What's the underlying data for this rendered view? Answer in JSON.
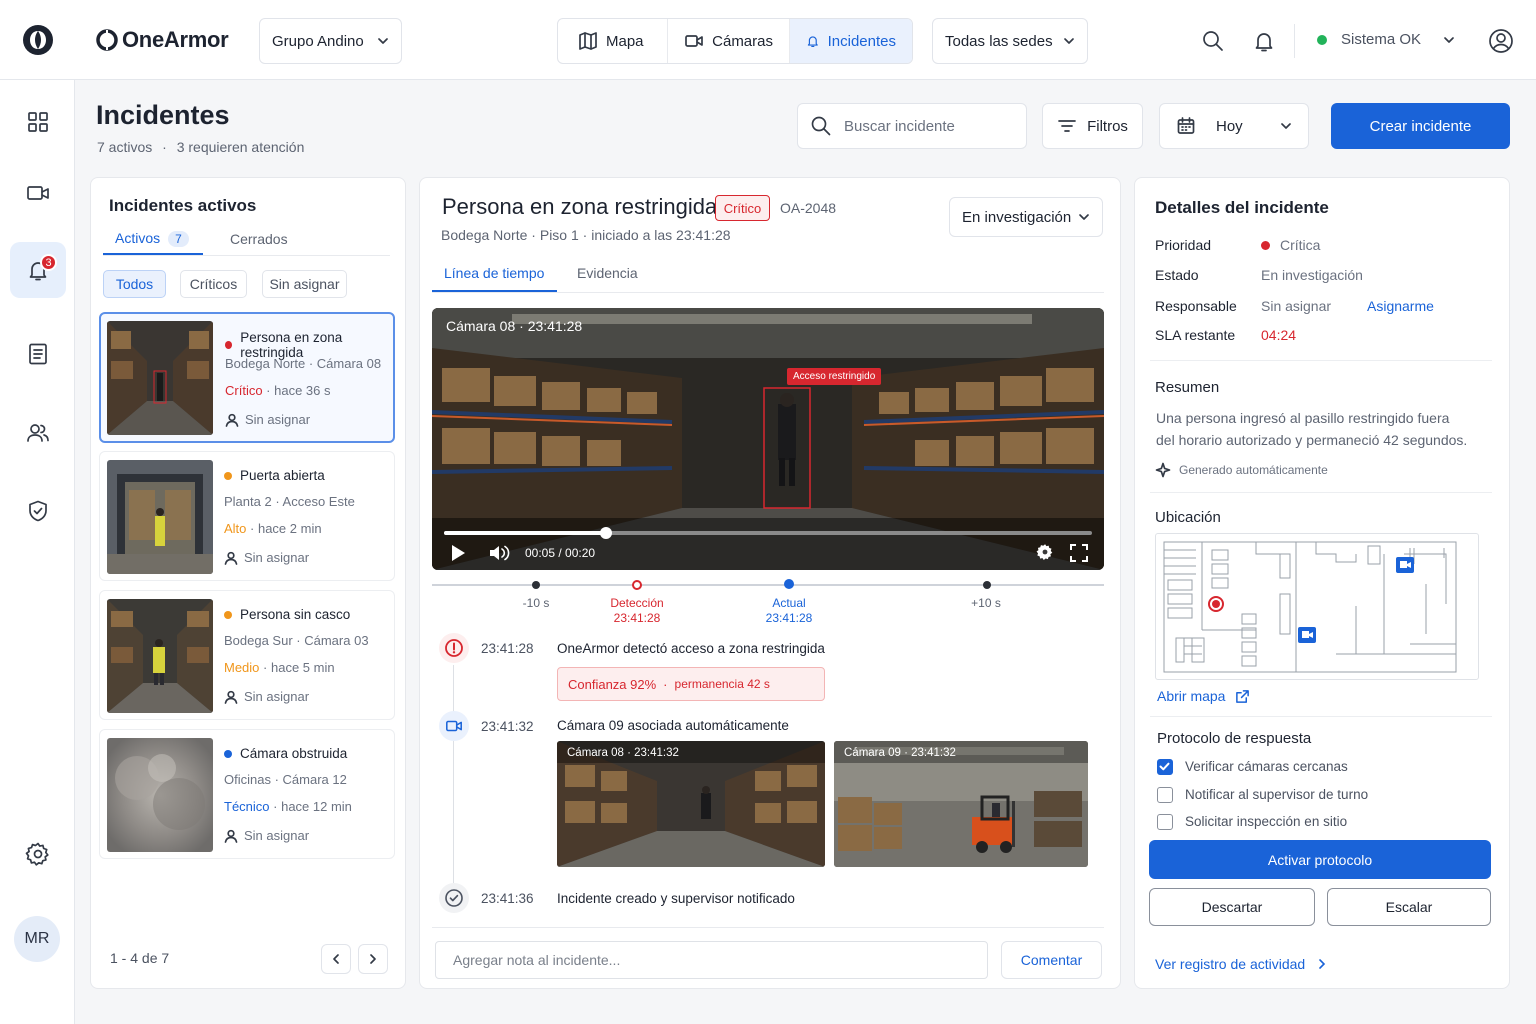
{
  "brand": {
    "name": "OneArmor",
    "logo_icon": "onearmor-logo-icon"
  },
  "topbar": {
    "org_select": "Grupo Andino",
    "nav": [
      {
        "label": "Mapa",
        "icon": "map-icon"
      },
      {
        "label": "Cámaras",
        "icon": "camera-icon"
      },
      {
        "label": "Incidentes",
        "icon": "bell-icon",
        "active": true
      }
    ],
    "site_select": "Todas las sedes",
    "system_status": "Sistema OK",
    "status_color": "#22b35a"
  },
  "sidebar": {
    "notifications_badge": "3",
    "avatar": "MR"
  },
  "header": {
    "title": "Incidentes",
    "subtitle_active": "7 activos",
    "subtitle_attention": "3 requieren atención",
    "search_placeholder": "Buscar incidente",
    "filters_label": "Filtros",
    "date_select": "Hoy",
    "create_button": "Crear incidente"
  },
  "list": {
    "title": "Incidentes activos",
    "tabs": {
      "active": "Activos",
      "active_count": "7",
      "closed": "Cerrados"
    },
    "filters": [
      "Todos",
      "Críticos",
      "Sin asignar"
    ],
    "items": [
      {
        "title": "Persona en zona restringida",
        "location": "Bodega Norte",
        "camera": "Cámara 08",
        "severity": "Crítico",
        "severity_color": "#d7272f",
        "time": "hace 36 s",
        "assignee": "Sin asignar"
      },
      {
        "title": "Puerta abierta",
        "location": "Planta 2",
        "camera": "Acceso Este",
        "severity": "Alto",
        "severity_color": "#f0961b",
        "time": "hace 2 min",
        "assignee": "Sin asignar"
      },
      {
        "title": "Persona sin casco",
        "location": "Bodega Sur",
        "camera": "Cámara 03",
        "severity": "Medio",
        "severity_color": "#f0961b",
        "time": "hace 5 min",
        "assignee": "Sin asignar"
      },
      {
        "title": "Cámara obstruida",
        "location": "Oficinas",
        "camera": "Cámara 12",
        "severity": "Técnico",
        "severity_color": "#1a63d8",
        "time": "hace 12 min",
        "assignee": "Sin asignar"
      }
    ],
    "pagination": "1 - 4 de 7"
  },
  "incident": {
    "title": "Persona en zona restringida",
    "severity": "Crítico",
    "id": "OA-2048",
    "location": "Bodega Norte",
    "floor": "Piso 1",
    "started": "iniciado a las 23:41:28",
    "status_select": "En investigación",
    "tabs": [
      "Línea de tiempo",
      "Evidencia"
    ],
    "video": {
      "overlay": "Cámara 08 · 23:41:28",
      "detection_tag": "Acceso restringido",
      "time": "00:05 / 00:20",
      "progress": 0.25
    },
    "timeline_marks": [
      {
        "label": "-10 s",
        "sub": ""
      },
      {
        "label": "Detección",
        "sub": "23:41:28"
      },
      {
        "label": "Actual",
        "sub": "23:41:28"
      },
      {
        "label": "+10 s",
        "sub": ""
      }
    ],
    "events": [
      {
        "time": "23:41:28",
        "text": "OneArmor detectó acceso a zona restringida",
        "confidence": "Confianza  92%",
        "dwell": "permanencia 42 s"
      },
      {
        "time": "23:41:32",
        "text": "Cámara 09 asociada automáticamente",
        "clip1": "Cámara 08 · 23:41:32",
        "clip2": "Cámara 09 · 23:41:32"
      },
      {
        "time": "23:41:36",
        "text": "Incidente creado y supervisor notificado"
      }
    ],
    "note_placeholder": "Agregar nota al incidente...",
    "comment_button": "Comentar"
  },
  "details": {
    "title": "Detalles del incidente",
    "rows": {
      "priority_label": "Prioridad",
      "priority_value": "Crítica",
      "status_label": "Estado",
      "status_value": "En investigación",
      "owner_label": "Responsable",
      "owner_value": "Sin asignar",
      "assign_link": "Asignarme",
      "sla_label": "SLA restante",
      "sla_value": "04:24"
    },
    "summary_title": "Resumen",
    "summary_line1": "Una persona ingresó al pasillo restringido fuera",
    "summary_line2": "del horario autorizado y permaneció 42 segundos.",
    "generated": "Generado automáticamente",
    "location_title": "Ubicación",
    "open_map": "Abrir mapa",
    "protocol_title": "Protocolo de respuesta",
    "protocol": [
      {
        "label": "Verificar cámaras cercanas",
        "checked": true
      },
      {
        "label": "Notificar al supervisor de turno",
        "checked": false
      },
      {
        "label": "Solicitar inspección en sitio",
        "checked": false
      }
    ],
    "activate": "Activar protocolo",
    "dismiss": "Descartar",
    "escalate": "Escalar",
    "activity_link": "Ver registro de actividad"
  }
}
